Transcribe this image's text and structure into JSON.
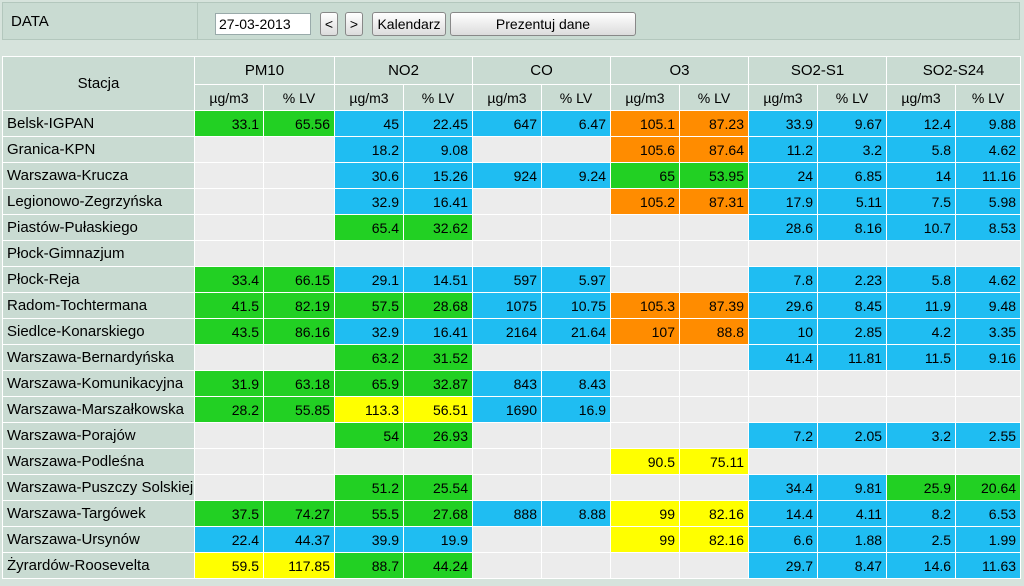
{
  "topbar": {
    "label": "DATA",
    "date_value": "27-03-2013",
    "prev_label": "<",
    "next_label": ">",
    "calendar_label": "Kalendarz",
    "show_label": "Prezentuj dane"
  },
  "colors": {
    "green": "#22d023",
    "blue": "#1fbdf2",
    "orange": "#ff8c00",
    "yellow": "#ffff00",
    "empty": "#ececec",
    "header": "#c9dbd2"
  },
  "table": {
    "station_header": "Stacja",
    "groups": [
      "PM10",
      "NO2",
      "CO",
      "O3",
      "SO2-S1",
      "SO2-S24"
    ],
    "unit_a": "µg/m3",
    "unit_b": "% LV",
    "rows": [
      {
        "name": "Belsk-IGPAN",
        "cells": [
          [
            "33.1",
            "g"
          ],
          [
            "65.56",
            "g"
          ],
          [
            "45",
            "b"
          ],
          [
            "22.45",
            "b"
          ],
          [
            "647",
            "b"
          ],
          [
            "6.47",
            "b"
          ],
          [
            "105.1",
            "o"
          ],
          [
            "87.23",
            "o"
          ],
          [
            "33.9",
            "b"
          ],
          [
            "9.67",
            "b"
          ],
          [
            "12.4",
            "b"
          ],
          [
            "9.88",
            "b"
          ]
        ]
      },
      {
        "name": "Granica-KPN",
        "cells": [
          [
            "",
            "e"
          ],
          [
            "",
            "e"
          ],
          [
            "18.2",
            "b"
          ],
          [
            "9.08",
            "b"
          ],
          [
            "",
            "e"
          ],
          [
            "",
            "e"
          ],
          [
            "105.6",
            "o"
          ],
          [
            "87.64",
            "o"
          ],
          [
            "11.2",
            "b"
          ],
          [
            "3.2",
            "b"
          ],
          [
            "5.8",
            "b"
          ],
          [
            "4.62",
            "b"
          ]
        ]
      },
      {
        "name": "Warszawa-Krucza",
        "cells": [
          [
            "",
            "e"
          ],
          [
            "",
            "e"
          ],
          [
            "30.6",
            "b"
          ],
          [
            "15.26",
            "b"
          ],
          [
            "924",
            "b"
          ],
          [
            "9.24",
            "b"
          ],
          [
            "65",
            "g"
          ],
          [
            "53.95",
            "g"
          ],
          [
            "24",
            "b"
          ],
          [
            "6.85",
            "b"
          ],
          [
            "14",
            "b"
          ],
          [
            "11.16",
            "b"
          ]
        ]
      },
      {
        "name": "Legionowo-Zegrzyńska",
        "cells": [
          [
            "",
            "e"
          ],
          [
            "",
            "e"
          ],
          [
            "32.9",
            "b"
          ],
          [
            "16.41",
            "b"
          ],
          [
            "",
            "e"
          ],
          [
            "",
            "e"
          ],
          [
            "105.2",
            "o"
          ],
          [
            "87.31",
            "o"
          ],
          [
            "17.9",
            "b"
          ],
          [
            "5.11",
            "b"
          ],
          [
            "7.5",
            "b"
          ],
          [
            "5.98",
            "b"
          ]
        ]
      },
      {
        "name": "Piastów-Pułaskiego",
        "cells": [
          [
            "",
            "e"
          ],
          [
            "",
            "e"
          ],
          [
            "65.4",
            "g"
          ],
          [
            "32.62",
            "g"
          ],
          [
            "",
            "e"
          ],
          [
            "",
            "e"
          ],
          [
            "",
            "e"
          ],
          [
            "",
            "e"
          ],
          [
            "28.6",
            "b"
          ],
          [
            "8.16",
            "b"
          ],
          [
            "10.7",
            "b"
          ],
          [
            "8.53",
            "b"
          ]
        ]
      },
      {
        "name": "Płock-Gimnazjum",
        "cells": [
          [
            "",
            "e"
          ],
          [
            "",
            "e"
          ],
          [
            "",
            "e"
          ],
          [
            "",
            "e"
          ],
          [
            "",
            "e"
          ],
          [
            "",
            "e"
          ],
          [
            "",
            "e"
          ],
          [
            "",
            "e"
          ],
          [
            "",
            "e"
          ],
          [
            "",
            "e"
          ],
          [
            "",
            "e"
          ],
          [
            "",
            "e"
          ]
        ]
      },
      {
        "name": "Płock-Reja",
        "cells": [
          [
            "33.4",
            "g"
          ],
          [
            "66.15",
            "g"
          ],
          [
            "29.1",
            "b"
          ],
          [
            "14.51",
            "b"
          ],
          [
            "597",
            "b"
          ],
          [
            "5.97",
            "b"
          ],
          [
            "",
            "e"
          ],
          [
            "",
            "e"
          ],
          [
            "7.8",
            "b"
          ],
          [
            "2.23",
            "b"
          ],
          [
            "5.8",
            "b"
          ],
          [
            "4.62",
            "b"
          ]
        ]
      },
      {
        "name": "Radom-Tochtermana",
        "cells": [
          [
            "41.5",
            "g"
          ],
          [
            "82.19",
            "g"
          ],
          [
            "57.5",
            "g"
          ],
          [
            "28.68",
            "g"
          ],
          [
            "1075",
            "b"
          ],
          [
            "10.75",
            "b"
          ],
          [
            "105.3",
            "o"
          ],
          [
            "87.39",
            "o"
          ],
          [
            "29.6",
            "b"
          ],
          [
            "8.45",
            "b"
          ],
          [
            "11.9",
            "b"
          ],
          [
            "9.48",
            "b"
          ]
        ]
      },
      {
        "name": "Siedlce-Konarskiego",
        "cells": [
          [
            "43.5",
            "g"
          ],
          [
            "86.16",
            "g"
          ],
          [
            "32.9",
            "b"
          ],
          [
            "16.41",
            "b"
          ],
          [
            "2164",
            "b"
          ],
          [
            "21.64",
            "b"
          ],
          [
            "107",
            "o"
          ],
          [
            "88.8",
            "o"
          ],
          [
            "10",
            "b"
          ],
          [
            "2.85",
            "b"
          ],
          [
            "4.2",
            "b"
          ],
          [
            "3.35",
            "b"
          ]
        ]
      },
      {
        "name": "Warszawa-Bernardyńska",
        "cells": [
          [
            "",
            "e"
          ],
          [
            "",
            "e"
          ],
          [
            "63.2",
            "g"
          ],
          [
            "31.52",
            "g"
          ],
          [
            "",
            "e"
          ],
          [
            "",
            "e"
          ],
          [
            "",
            "e"
          ],
          [
            "",
            "e"
          ],
          [
            "41.4",
            "b"
          ],
          [
            "11.81",
            "b"
          ],
          [
            "11.5",
            "b"
          ],
          [
            "9.16",
            "b"
          ]
        ]
      },
      {
        "name": "Warszawa-Komunikacyjna",
        "cells": [
          [
            "31.9",
            "g"
          ],
          [
            "63.18",
            "g"
          ],
          [
            "65.9",
            "g"
          ],
          [
            "32.87",
            "g"
          ],
          [
            "843",
            "b"
          ],
          [
            "8.43",
            "b"
          ],
          [
            "",
            "e"
          ],
          [
            "",
            "e"
          ],
          [
            "",
            "e"
          ],
          [
            "",
            "e"
          ],
          [
            "",
            "e"
          ],
          [
            "",
            "e"
          ]
        ]
      },
      {
        "name": "Warszawa-Marszałkowska",
        "cells": [
          [
            "28.2",
            "g"
          ],
          [
            "55.85",
            "g"
          ],
          [
            "113.3",
            "y"
          ],
          [
            "56.51",
            "y"
          ],
          [
            "1690",
            "b"
          ],
          [
            "16.9",
            "b"
          ],
          [
            "",
            "e"
          ],
          [
            "",
            "e"
          ],
          [
            "",
            "e"
          ],
          [
            "",
            "e"
          ],
          [
            "",
            "e"
          ],
          [
            "",
            "e"
          ]
        ]
      },
      {
        "name": "Warszawa-Porajów",
        "cells": [
          [
            "",
            "e"
          ],
          [
            "",
            "e"
          ],
          [
            "54",
            "g"
          ],
          [
            "26.93",
            "g"
          ],
          [
            "",
            "e"
          ],
          [
            "",
            "e"
          ],
          [
            "",
            "e"
          ],
          [
            "",
            "e"
          ],
          [
            "7.2",
            "b"
          ],
          [
            "2.05",
            "b"
          ],
          [
            "3.2",
            "b"
          ],
          [
            "2.55",
            "b"
          ]
        ]
      },
      {
        "name": "Warszawa-Podleśna",
        "cells": [
          [
            "",
            "e"
          ],
          [
            "",
            "e"
          ],
          [
            "",
            "e"
          ],
          [
            "",
            "e"
          ],
          [
            "",
            "e"
          ],
          [
            "",
            "e"
          ],
          [
            "90.5",
            "y"
          ],
          [
            "75.11",
            "y"
          ],
          [
            "",
            "e"
          ],
          [
            "",
            "e"
          ],
          [
            "",
            "e"
          ],
          [
            "",
            "e"
          ]
        ]
      },
      {
        "name": "Warszawa-Puszczy Solskiej",
        "cells": [
          [
            "",
            "e"
          ],
          [
            "",
            "e"
          ],
          [
            "51.2",
            "g"
          ],
          [
            "25.54",
            "g"
          ],
          [
            "",
            "e"
          ],
          [
            "",
            "e"
          ],
          [
            "",
            "e"
          ],
          [
            "",
            "e"
          ],
          [
            "34.4",
            "b"
          ],
          [
            "9.81",
            "b"
          ],
          [
            "25.9",
            "g"
          ],
          [
            "20.64",
            "g"
          ]
        ]
      },
      {
        "name": "Warszawa-Targówek",
        "cells": [
          [
            "37.5",
            "g"
          ],
          [
            "74.27",
            "g"
          ],
          [
            "55.5",
            "g"
          ],
          [
            "27.68",
            "g"
          ],
          [
            "888",
            "b"
          ],
          [
            "8.88",
            "b"
          ],
          [
            "99",
            "y"
          ],
          [
            "82.16",
            "y"
          ],
          [
            "14.4",
            "b"
          ],
          [
            "4.11",
            "b"
          ],
          [
            "8.2",
            "b"
          ],
          [
            "6.53",
            "b"
          ]
        ]
      },
      {
        "name": "Warszawa-Ursynów",
        "cells": [
          [
            "22.4",
            "b"
          ],
          [
            "44.37",
            "b"
          ],
          [
            "39.9",
            "b"
          ],
          [
            "19.9",
            "b"
          ],
          [
            "",
            "e"
          ],
          [
            "",
            "e"
          ],
          [
            "99",
            "y"
          ],
          [
            "82.16",
            "y"
          ],
          [
            "6.6",
            "b"
          ],
          [
            "1.88",
            "b"
          ],
          [
            "2.5",
            "b"
          ],
          [
            "1.99",
            "b"
          ]
        ]
      },
      {
        "name": "Żyrardów-Roosevelta",
        "cells": [
          [
            "59.5",
            "y"
          ],
          [
            "117.85",
            "y"
          ],
          [
            "88.7",
            "g"
          ],
          [
            "44.24",
            "g"
          ],
          [
            "",
            "e"
          ],
          [
            "",
            "e"
          ],
          [
            "",
            "e"
          ],
          [
            "",
            "e"
          ],
          [
            "29.7",
            "b"
          ],
          [
            "8.47",
            "b"
          ],
          [
            "14.6",
            "b"
          ],
          [
            "11.63",
            "b"
          ]
        ]
      }
    ]
  }
}
